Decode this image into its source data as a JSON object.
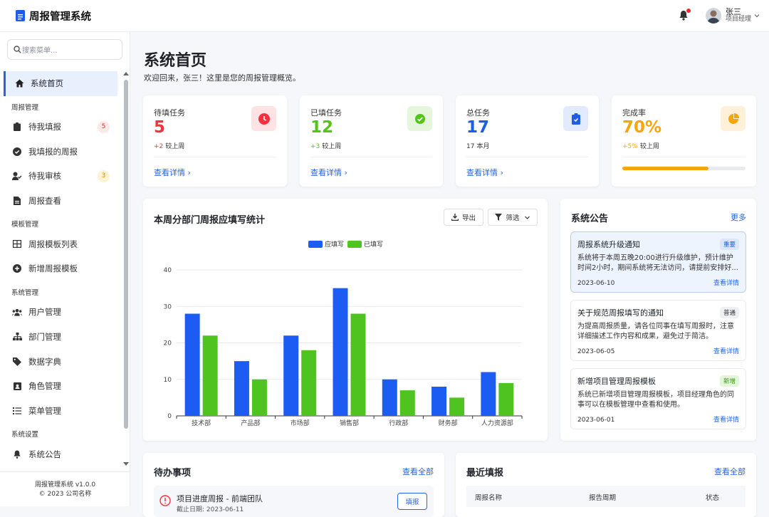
{
  "app": {
    "title": "周报管理系统"
  },
  "header": {
    "user_name": "张三",
    "user_role": "项目经理"
  },
  "sidebar": {
    "search_placeholder": "搜索菜单...",
    "items": [
      {
        "label": "系统首页"
      },
      {
        "group": "周报管理"
      },
      {
        "label": "待我填报",
        "badge": "5"
      },
      {
        "label": "我填报的周报"
      },
      {
        "label": "待我审核",
        "badge": "3"
      },
      {
        "label": "周报查看"
      },
      {
        "group": "模板管理"
      },
      {
        "label": "周报模板列表"
      },
      {
        "label": "新增周报模板"
      },
      {
        "group": "系统管理"
      },
      {
        "label": "用户管理"
      },
      {
        "label": "部门管理"
      },
      {
        "label": "数据字典"
      },
      {
        "label": "角色管理"
      },
      {
        "label": "菜单管理"
      },
      {
        "group": "系统设置"
      },
      {
        "label": "系统公告"
      }
    ],
    "footer_version": "周报管理系统 v1.0.0",
    "footer_copy": "© 2023 公司名称"
  },
  "page": {
    "title": "系统首页",
    "subtitle": "欢迎回来，张三！这里是您的周报管理概览。"
  },
  "stats": [
    {
      "label": "待填任务",
      "value": "5",
      "delta": "+2",
      "delta_text": "较上周",
      "link": "查看详情",
      "color": "#f5313d"
    },
    {
      "label": "已填任务",
      "value": "12",
      "delta": "+3",
      "delta_text": "较上周",
      "link": "查看详情",
      "color": "#52c41a"
    },
    {
      "label": "总任务",
      "value": "17",
      "delta": "17",
      "delta_text": "本月",
      "link": "查看详情",
      "color": "#1d5de8"
    },
    {
      "label": "完成率",
      "value": "70%",
      "delta": "+5%",
      "delta_text": "较上周",
      "progress": 0.7,
      "color": "#f5a70a"
    }
  ],
  "chart_section": {
    "title": "本周分部门周报应填写统计",
    "export_label": "导出",
    "filter_label": "筛选"
  },
  "chart_data": {
    "type": "bar",
    "categories": [
      "技术部",
      "产品部",
      "市场部",
      "销售部",
      "行政部",
      "财务部",
      "人力资源部"
    ],
    "series": [
      {
        "name": "应填写",
        "values": [
          28,
          15,
          22,
          35,
          10,
          8,
          12
        ],
        "color": "#1d5cf2"
      },
      {
        "name": "已填写",
        "values": [
          22,
          10,
          18,
          28,
          7,
          5,
          9
        ],
        "color": "#4fc421"
      }
    ],
    "yticks": [
      "0",
      "10",
      "20",
      "30",
      "40"
    ],
    "ylim": [
      0,
      40
    ],
    "grid": true,
    "legend": "top"
  },
  "announcements": {
    "title": "系统公告",
    "more": "更多",
    "items": [
      {
        "title": "周报系统升级通知",
        "tag": "重要",
        "desc": "系统将于本周五晚20:00进行升级维护，预计维护时间2小时，期间系统将无法访问，请提前安排好...",
        "date": "2023-06-10",
        "link": "查看详情"
      },
      {
        "title": "关于规范周报填写的通知",
        "tag": "普通",
        "desc": "为提高周报质量，请各位同事在填写周报时，注意详细描述工作内容和成果，避免过于简洁。",
        "date": "2023-06-05",
        "link": "查看详情"
      },
      {
        "title": "新增项目管理周报模板",
        "tag": "新增",
        "desc": "系统已新增项目管理周报模板，项目经理角色的同事可以在模板管理中查看和使用。",
        "date": "2023-06-01",
        "link": "查看详情"
      }
    ]
  },
  "todo": {
    "title": "待办事项",
    "more": "查看全部",
    "item_title": "项目进度周报 - 前端团队",
    "item_sub": "截止日期: 2023-06-11",
    "item_btn": "填报"
  },
  "recent": {
    "title": "最近填报",
    "more": "查看全部",
    "columns": [
      "周报名称",
      "报告周期",
      "状态"
    ]
  }
}
